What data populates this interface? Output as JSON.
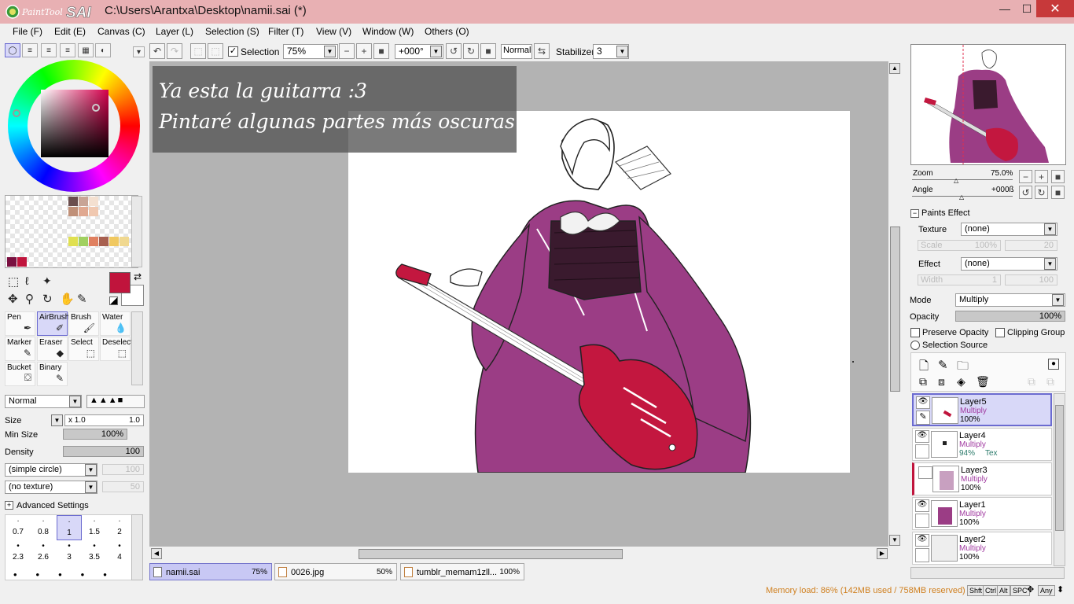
{
  "window": {
    "app_name": "PaintTool SAI",
    "title": "C:\\Users\\Arantxa\\Desktop\\namii.sai (*)",
    "minimize": "—",
    "maximize": "☐",
    "close": "✕"
  },
  "menu": [
    "File (F)",
    "Edit (E)",
    "Canvas (C)",
    "Layer (L)",
    "Selection (S)",
    "Filter (T)",
    "View (V)",
    "Window (W)",
    "Others (O)"
  ],
  "toolbar": {
    "selection_label": "Selection",
    "selection_checked": true,
    "zoom": "75%",
    "angle": "+000°",
    "blend": "Normal",
    "stabilizer_label": "Stabilizer",
    "stabilizer": "3"
  },
  "canvas": {
    "caption_line1": "Ya esta la guitarra :3",
    "caption_line2": "Pintaré algunas partes más oscuras"
  },
  "colors": {
    "primary": "#c0143c",
    "secondary": "#ffffff",
    "kimono": "#9b3d85",
    "guitar": "#c3173f",
    "obi": "#3a1a2e",
    "selection_blue": "#6b6bd0",
    "title_bar": "#e8b0b3"
  },
  "swatches": [
    "#6b4e4e",
    "#c8a496",
    "#e8c8b8",
    "#f4e0d0",
    "#c09078",
    "#e0a890",
    "#f0c8b0",
    "#e0e050",
    "#a0d060",
    "#e08060",
    "#a86050",
    "#f0c860",
    "#f0d890",
    "#7a1040",
    "#c0143c"
  ],
  "tools": {
    "items": [
      {
        "label": "Pen",
        "icon": "pen-icon",
        "selected": false
      },
      {
        "label": "AirBrush",
        "icon": "airbrush-icon",
        "selected": true
      },
      {
        "label": "Brush",
        "icon": "brush-icon",
        "selected": false
      },
      {
        "label": "Water",
        "icon": "water-icon",
        "selected": false
      },
      {
        "label": "Marker",
        "icon": "marker-icon",
        "selected": false
      },
      {
        "label": "Eraser",
        "icon": "eraser-icon",
        "selected": false
      },
      {
        "label": "Select",
        "icon": "select-icon",
        "selected": false
      },
      {
        "label": "Deselect",
        "icon": "deselect-icon",
        "selected": false
      },
      {
        "label": "Bucket",
        "icon": "bucket-icon",
        "selected": false
      },
      {
        "label": "Binary",
        "icon": "binary-icon",
        "selected": false
      }
    ]
  },
  "brush": {
    "mode": "Normal",
    "size_label": "Size",
    "size_mult": "x 1.0",
    "size": "1.0",
    "min_size_label": "Min Size",
    "min_size": "100%",
    "density_label": "Density",
    "density": "100",
    "shape": "(simple circle)",
    "shape_value": "100",
    "texture": "(no texture)",
    "texture_value": "50",
    "advanced": "Advanced Settings",
    "presets": [
      "0.7",
      "0.8",
      "1",
      "1.5",
      "2",
      "2.3",
      "2.6",
      "3",
      "3.5",
      "4"
    ],
    "selected_preset": "1"
  },
  "navigator": {
    "zoom_label": "Zoom",
    "zoom": "75.0%",
    "angle_label": "Angle",
    "angle": "+000ß"
  },
  "paints_effect": {
    "header": "Paints Effect",
    "texture_label": "Texture",
    "texture": "(none)",
    "scale_label": "Scale",
    "scale": "100%",
    "scale_value": "20",
    "effect_label": "Effect",
    "effect": "(none)",
    "width_label": "Width",
    "width": "1",
    "width_value": "100"
  },
  "layer_props": {
    "mode_label": "Mode",
    "mode": "Multiply",
    "opacity_label": "Opacity",
    "opacity": "100%",
    "preserve_opacity": "Preserve Opacity",
    "clipping_group": "Clipping Group",
    "selection_source": "Selection Source"
  },
  "layers": [
    {
      "name": "Layer5",
      "mode": "Multiply",
      "opacity": "100%",
      "extra": "",
      "selected": true
    },
    {
      "name": "Layer4",
      "mode": "Multiply",
      "opacity": "94%",
      "extra": "Tex",
      "selected": false
    },
    {
      "name": "Layer3",
      "mode": "Multiply",
      "opacity": "100%",
      "extra": "",
      "selected": false
    },
    {
      "name": "Layer1",
      "mode": "Multiply",
      "opacity": "100%",
      "extra": "",
      "selected": false
    },
    {
      "name": "Layer2",
      "mode": "Multiply",
      "opacity": "100%",
      "extra": "",
      "selected": false
    }
  ],
  "documents": [
    {
      "name": "namii.sai",
      "zoom": "75%",
      "active": true
    },
    {
      "name": "0026.jpg",
      "zoom": "50%",
      "active": false
    },
    {
      "name": "tumblr_memam1zll...",
      "zoom": "100%",
      "active": false
    }
  ],
  "status": {
    "memory": "Memory load: 86% (142MB used / 758MB reserved)",
    "keys": [
      "Shft",
      "Ctrl",
      "Alt",
      "SPC",
      "Any"
    ]
  }
}
